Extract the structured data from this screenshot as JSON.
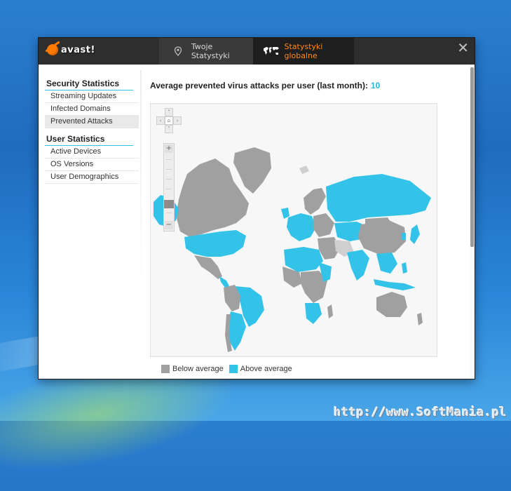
{
  "window": {
    "logo_text": "avast!",
    "tabs": [
      {
        "label": "Twoje Statystyki",
        "icon": "location-pin-icon",
        "active": false
      },
      {
        "label": "Statystyki globalne",
        "icon": "world-map-icon",
        "active": true
      }
    ],
    "close_icon": "close-icon"
  },
  "sidebar": {
    "sections": [
      {
        "title": "Security Statistics",
        "items": [
          "Streaming Updates",
          "Infected Domains",
          "Prevented Attacks"
        ],
        "active": "Prevented Attacks"
      },
      {
        "title": "User Statistics",
        "items": [
          "Active Devices",
          "OS Versions",
          "User Demographics"
        ]
      }
    ]
  },
  "main": {
    "heading_label": "Average prevented virus attacks per user (last month):",
    "heading_value": "10",
    "map": {
      "controls": {
        "home_icon": "home-icon",
        "zoom_in": "+",
        "zoom_out": "−"
      },
      "colors": {
        "below": "#a0a0a0",
        "above": "#33c3e8",
        "light": "#cfcfcf"
      }
    },
    "legend": [
      {
        "label": "Below average",
        "color": "#a0a0a0"
      },
      {
        "label": "Above average",
        "color": "#33c3e8"
      }
    ]
  },
  "desktop": {
    "watermark": "http://www.SoftMania.pl"
  }
}
